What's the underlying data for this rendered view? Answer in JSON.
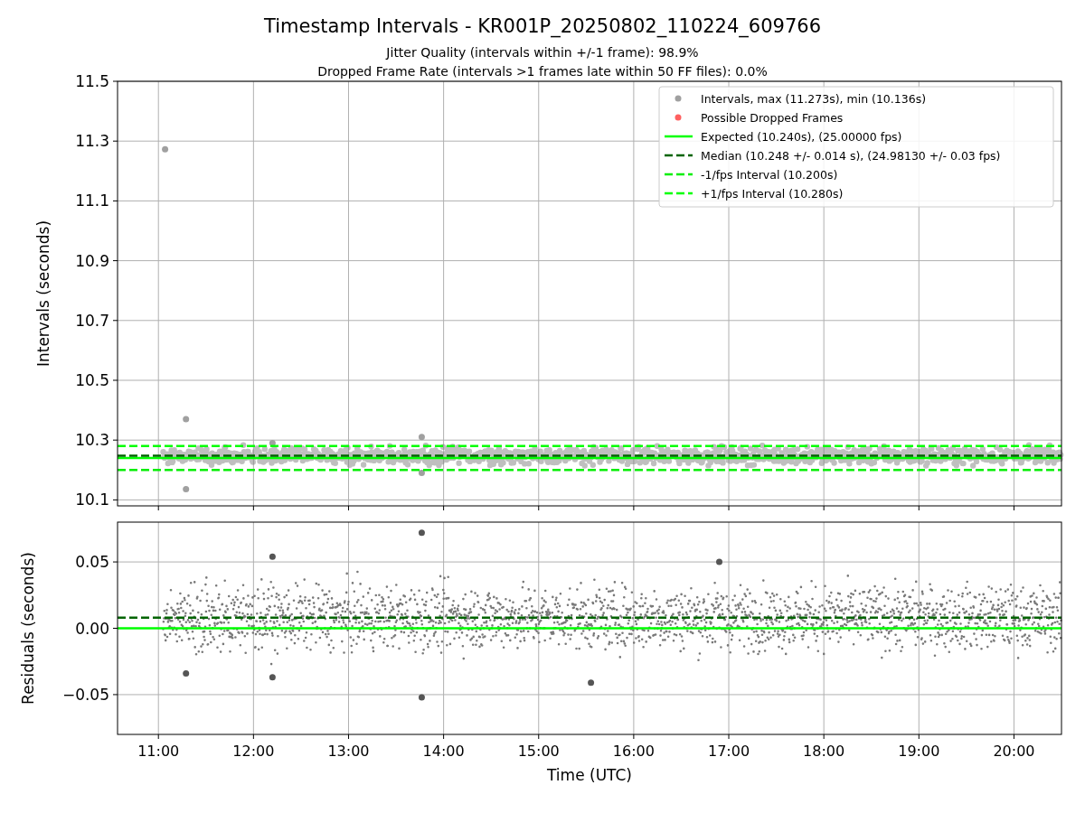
{
  "title": "Timestamp Intervals - KR001P_20250802_110224_609766",
  "subtitles": [
    "Jitter Quality (intervals within +/-1 frame): 98.9%",
    "Dropped Frame Rate (intervals >1 frames late within 50 FF files): 0.0%"
  ],
  "charts": [
    {
      "chart_data": {
        "type": "scatter",
        "grid": true,
        "ylabel": "Intervals (seconds)",
        "xlim": [
          10.57,
          20.5
        ],
        "ylim": [
          10.08,
          11.5
        ],
        "yticks": [
          {
            "value": 10.1,
            "label": "10.1"
          },
          {
            "value": 10.3,
            "label": "10.3"
          },
          {
            "value": 10.5,
            "label": "10.5"
          },
          {
            "value": 10.7,
            "label": "10.7"
          },
          {
            "value": 10.9,
            "label": "10.9"
          },
          {
            "value": 11.1,
            "label": "11.1"
          },
          {
            "value": 11.3,
            "label": "11.3"
          },
          {
            "value": 11.5,
            "label": "11.5"
          }
        ],
        "series": [
          {
            "name": "Intervals, max (11.273s), min (10.136s)",
            "type": "scatter",
            "color": "#a0a0a0",
            "x": [
              11.07,
              11.29,
              11.29,
              13.77,
              13.77,
              12.2
            ],
            "values": [
              11.273,
              10.37,
              10.136,
              10.31,
              10.19,
              10.29
            ]
          },
          {
            "name": "Possible Dropped Frames",
            "type": "scatter",
            "color": "#ff6060"
          },
          {
            "name": "Expected (10.240s), (25.00000 fps)",
            "type": "line",
            "line_style": "solid",
            "color": "#00ff00",
            "x": [
              10.57,
              20.5
            ],
            "values": [
              10.24,
              10.24
            ]
          },
          {
            "name": "Median (10.248 +/- 0.014 s), (24.98130 +/- 0.03 fps)",
            "type": "line",
            "line_style": "dashed",
            "color": "#006400",
            "x": [
              10.57,
              20.5
            ],
            "values": [
              10.248,
              10.248
            ]
          },
          {
            "name": "-1/fps Interval (10.200s)",
            "type": "line",
            "line_style": "dashed",
            "color": "#00ee00",
            "x": [
              10.57,
              20.5
            ],
            "values": [
              10.2,
              10.2
            ]
          },
          {
            "name": "+1/fps Interval (10.280s)",
            "type": "line",
            "line_style": "dashed",
            "color": "#00ff00",
            "x": [
              10.57,
              20.5
            ],
            "values": [
              10.28,
              10.28
            ]
          }
        ]
      }
    },
    {
      "chart_data": {
        "type": "scatter",
        "grid": true,
        "xlabel": "Time (UTC)",
        "ylabel": "Residuals (seconds)",
        "xlim": [
          10.57,
          20.5
        ],
        "ylim": [
          -0.08,
          0.08
        ],
        "xticks": [
          {
            "value": 11,
            "label": "11:00"
          },
          {
            "value": 12,
            "label": "12:00"
          },
          {
            "value": 13,
            "label": "13:00"
          },
          {
            "value": 14,
            "label": "14:00"
          },
          {
            "value": 15,
            "label": "15:00"
          },
          {
            "value": 16,
            "label": "16:00"
          },
          {
            "value": 17,
            "label": "17:00"
          },
          {
            "value": 18,
            "label": "18:00"
          },
          {
            "value": 19,
            "label": "19:00"
          },
          {
            "value": 20,
            "label": "20:00"
          }
        ],
        "yticks": [
          {
            "value": 0.05,
            "label": "0.05"
          },
          {
            "value": 0,
            "label": "0.00"
          },
          {
            "value": -0.05,
            "label": "−0.05"
          }
        ],
        "series": [
          {
            "type": "scatter",
            "color": "#555555",
            "x": [
              11.29,
              12.2,
              12.2,
              13.77,
              13.77,
              15.55,
              16.9
            ],
            "values": [
              -0.034,
              0.054,
              -0.037,
              0.072,
              -0.052,
              -0.041,
              0.05
            ]
          },
          {
            "type": "line",
            "line_style": "dashed",
            "color": "#006400",
            "x": [
              10.57,
              20.5
            ],
            "values": [
              0.008,
              0.008
            ]
          },
          {
            "type": "line",
            "line_style": "solid",
            "color": "#00ff00",
            "x": [
              10.57,
              20.5
            ],
            "values": [
              0,
              0
            ]
          }
        ]
      }
    }
  ]
}
